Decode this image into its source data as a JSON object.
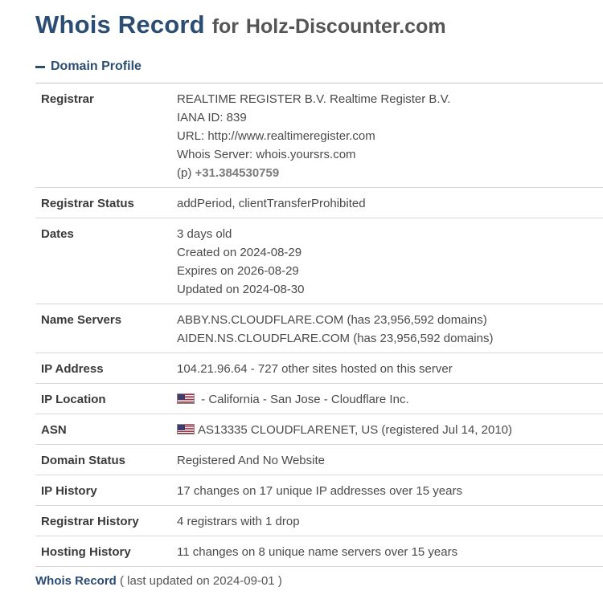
{
  "header": {
    "title": "Whois Record",
    "for_word": "for",
    "domain": "Holz-Discounter.com"
  },
  "section": {
    "label": "Domain Profile"
  },
  "rows": {
    "registrar": {
      "label": "Registrar",
      "name": "REALTIME REGISTER B.V. Realtime Register B.V.",
      "iana": "IANA ID: 839",
      "url": "URL: http://www.realtimeregister.com",
      "whois_server": "Whois Server: whois.yoursrs.com",
      "phone_prefix": "(p)",
      "phone": "+31.384530759"
    },
    "registrar_status": {
      "label": "Registrar Status",
      "value": "addPeriod, clientTransferProhibited"
    },
    "dates": {
      "label": "Dates",
      "age": "3 days old",
      "created": "Created on 2024-08-29",
      "expires": "Expires on 2026-08-29",
      "updated": "Updated on 2024-08-30"
    },
    "name_servers": {
      "label": "Name Servers",
      "ns1": "ABBY.NS.CLOUDFLARE.COM (has 23,956,592 domains)",
      "ns2": "AIDEN.NS.CLOUDFLARE.COM (has 23,956,592 domains)"
    },
    "ip_address": {
      "label": "IP Address",
      "value": "104.21.96.64 - 727 other sites hosted on this server"
    },
    "ip_location": {
      "label": "IP Location",
      "value": " - California - San Jose - Cloudflare Inc.",
      "flag_icon": "us-flag-icon"
    },
    "asn": {
      "label": "ASN",
      "value": "AS13335 CLOUDFLARENET, US (registered Jul 14, 2010)",
      "flag_icon": "us-flag-icon"
    },
    "domain_status": {
      "label": "Domain Status",
      "value": "Registered And No Website"
    },
    "ip_history": {
      "label": "IP History",
      "value": "17 changes on 17 unique IP addresses over 15 years"
    },
    "registrar_history": {
      "label": "Registrar History",
      "value": "4 registrars with 1 drop"
    },
    "hosting_history": {
      "label": "Hosting History",
      "value": "11 changes on 8 unique name servers over 15 years"
    }
  },
  "footer": {
    "link": "Whois Record",
    "note": " ( last updated on 2024-09-01 )"
  },
  "colors": {
    "accent": "#2b4d73",
    "text": "#4a4a4a",
    "border": "#d8d8d8"
  }
}
